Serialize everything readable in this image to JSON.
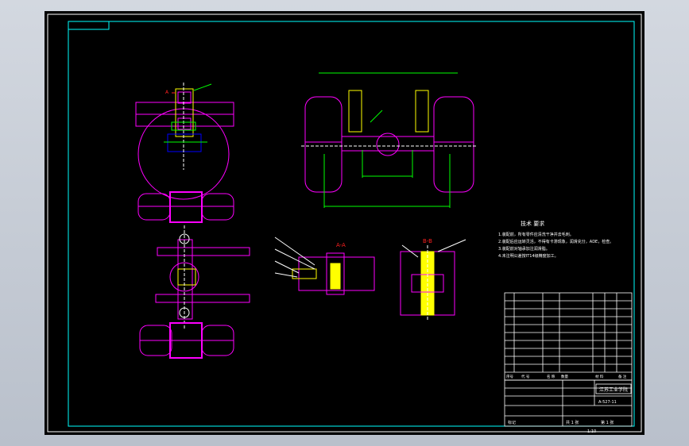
{
  "colors": {
    "background": "#000000",
    "frame": "#ffffff",
    "border": "#00ffff",
    "magenta": "#ff00ff",
    "yellow": "#ffff00",
    "green": "#00ff00",
    "blue": "#0000ff",
    "red": "#ff2020",
    "white": "#ffffff"
  },
  "notes": {
    "title": "技术 要求",
    "lines": [
      "1.装配前，所有零件应清洗干净并去毛刺。",
      "2.装配后应运转灵活，不得有卡滞现象，润滑充分，ADE，检查。",
      "3.装配前对轴承加注润滑脂。",
      "4.未注明公差按IT14级精度加工。"
    ]
  },
  "section_labels": {
    "a": "A-A",
    "b": "B-B",
    "left_marker": "A"
  },
  "titleblock": {
    "school": "江苏工业学院",
    "drawing_name": "A-527-11",
    "footer_left": "标记",
    "footer_mid": "共 1 张",
    "footer_right": "第 1 张",
    "header_cells": [
      "序号",
      "代 号",
      "名 称",
      "数量",
      "材 料",
      "备 注"
    ]
  },
  "scale_label": "1:10",
  "icons": [
    "cad-drawing-icon"
  ]
}
